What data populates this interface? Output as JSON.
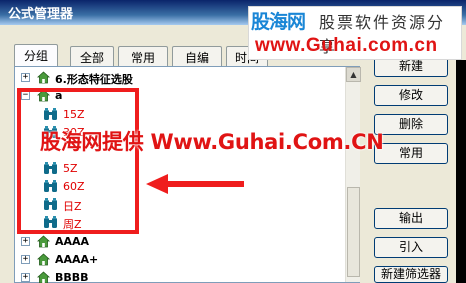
{
  "window": {
    "title": "公式管理器"
  },
  "watermark": {
    "logo": "股海网",
    "slogan": "股票软件资源分享",
    "url": "www.Guhai.com.cn"
  },
  "tabs": [
    {
      "label": "分组",
      "active": true
    },
    {
      "label": "全部",
      "active": false
    },
    {
      "label": "常用",
      "active": false
    },
    {
      "label": "自编",
      "active": false
    },
    {
      "label": "时间",
      "active": false
    }
  ],
  "tree": {
    "top_node": {
      "expander": "+",
      "label": "6.形态特征选股",
      "icon": "house-icon"
    },
    "group_a": {
      "expander": "−",
      "label": "a",
      "icon": "house-icon",
      "items": [
        {
          "label": "15Z",
          "icon": "binoculars-icon"
        },
        {
          "label": "30Z",
          "icon": "binoculars-icon"
        },
        {
          "label": "5Z",
          "icon": "binoculars-icon"
        },
        {
          "label": "60Z",
          "icon": "binoculars-icon"
        },
        {
          "label": "日Z",
          "icon": "binoculars-icon"
        },
        {
          "label": "周Z",
          "icon": "binoculars-icon"
        }
      ]
    },
    "bottom_nodes": [
      {
        "expander": "+",
        "label": "AAAA",
        "icon": "house-icon"
      },
      {
        "expander": "+",
        "label": "AAAA+",
        "icon": "house-icon"
      },
      {
        "expander": "+",
        "label": "BBBB",
        "icon": "house-icon"
      }
    ]
  },
  "buttons": {
    "new": "新建",
    "modify": "修改",
    "delete": "删除",
    "common": "常用",
    "export": "输出",
    "import": "引入",
    "new_screener": "新建筛选器"
  },
  "overlay": {
    "text": "股海网提供 Www.Guhai.Com.CN"
  },
  "colors": {
    "annotation_red": "#ef1d1d",
    "item_red": "#e00000",
    "titlebar": "#0a246a",
    "watermark_blue": "#1a86d6"
  }
}
